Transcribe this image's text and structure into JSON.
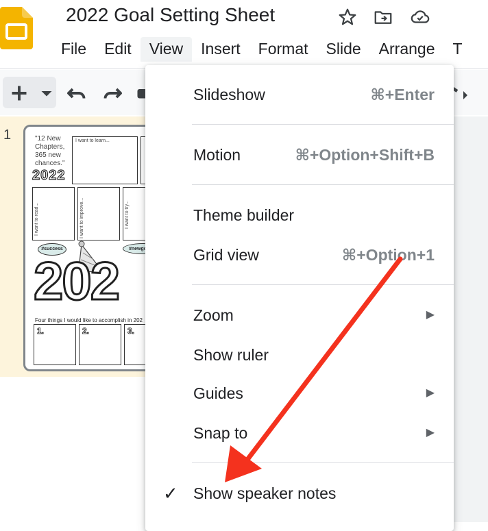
{
  "app": {
    "doc_title": "2022 Goal Setting Sheet",
    "icons": [
      "slides-logo-icon",
      "star-icon",
      "move-to-folder-icon",
      "cloud-saved-icon"
    ]
  },
  "menubar": {
    "items": [
      "File",
      "Edit",
      "View",
      "Insert",
      "Format",
      "Slide",
      "Arrange",
      "T"
    ],
    "active": "View"
  },
  "toolbar": {
    "icons": [
      "add-icon",
      "dropdown-caret-icon",
      "undo-icon",
      "redo-icon",
      "print-icon",
      "paint-format-icon"
    ]
  },
  "filmstrip": {
    "slide_number": "1",
    "thumbnail": {
      "quote": "\"12 New Chapters, 365 new chances.\"",
      "year_small": "2022",
      "boxes": [
        "I want to learn...",
        "I want to read...",
        "I want to improve...",
        "I want to try..."
      ],
      "bubbles": [
        "#success",
        "#newgo"
      ],
      "big_year": "202",
      "accomplish_text": "Four things I would like to accomplish in 202",
      "numbers": [
        "1.",
        "2.",
        "3."
      ]
    }
  },
  "view_menu": {
    "items": [
      {
        "label": "Slideshow",
        "shortcut": "⌘+Enter"
      },
      {
        "label": "Motion",
        "shortcut": "⌘+Option+Shift+B"
      },
      {
        "label": "Theme builder",
        "shortcut": ""
      },
      {
        "label": "Grid view",
        "shortcut": "⌘+Option+1"
      },
      {
        "label": "Zoom",
        "submenu": true
      },
      {
        "label": "Show ruler",
        "shortcut": ""
      },
      {
        "label": "Guides",
        "submenu": true
      },
      {
        "label": "Snap to",
        "submenu": true
      },
      {
        "label": "Show speaker notes",
        "checked": true
      }
    ],
    "check_mark": "✓",
    "submenu_arrow": "▶"
  },
  "annotation": {
    "color": "#f4321e",
    "points_to": "Show speaker notes"
  }
}
